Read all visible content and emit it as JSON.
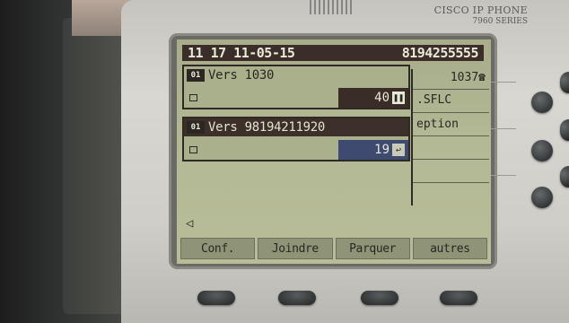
{
  "brand": {
    "line1": "CISCO IP PHONE",
    "line2": "7960 SERIES"
  },
  "header": {
    "datetime": "11 17 11-05-15",
    "number": "8194255555"
  },
  "calls": [
    {
      "line_icon": "01",
      "label": "Vers 1030",
      "timer": "40",
      "timer_icon": "pause-icon"
    },
    {
      "line_icon": "01",
      "label": "Vers 98194211920",
      "timer": "19",
      "timer_icon": "phone-off-hook-icon"
    }
  ],
  "right_panel": {
    "ext": "1037",
    "item2": ".SFLC",
    "item3": "eption"
  },
  "speaker_icon": "speaker-icon",
  "softkeys": [
    "Conf.",
    "Joindre",
    "Parquer",
    "autres"
  ],
  "colors": {
    "lcd": "#b3b995",
    "dark": "#3b2e2a",
    "highlight": "#3f4a70"
  }
}
